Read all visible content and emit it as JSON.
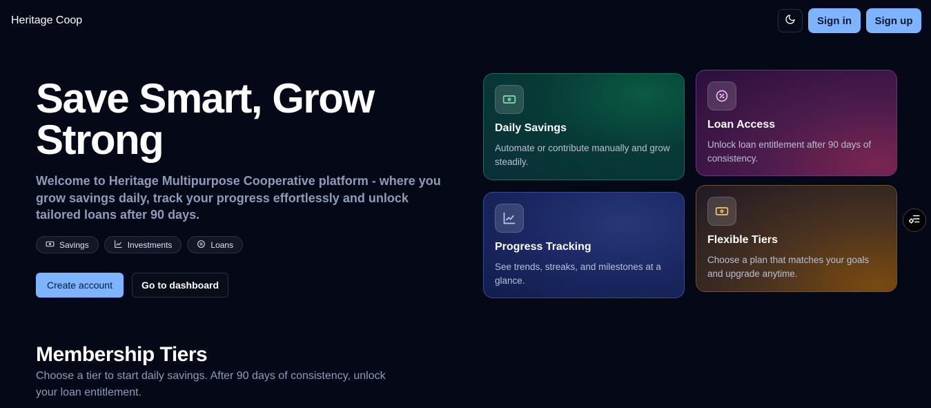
{
  "header": {
    "brand": "Heritage Coop",
    "theme_toggle_icon": "moon-icon",
    "signin_label": "Sign in",
    "signup_label": "Sign up"
  },
  "hero": {
    "title": "Save Smart, Grow Strong",
    "subtitle": "Welcome to Heritage Multipurpose Cooperative platform - where you grow savings daily, track your progress effortlessly and unlock tailored loans after 90 days.",
    "chips": [
      {
        "label": "Savings",
        "icon": "cash-icon"
      },
      {
        "label": "Investments",
        "icon": "chart-line-icon"
      },
      {
        "label": "Loans",
        "icon": "percent-badge-icon"
      }
    ],
    "cta_primary": "Create account",
    "cta_secondary": "Go to dashboard"
  },
  "features": [
    {
      "title": "Daily Savings",
      "desc": "Automate or contribute manually and grow steadily.",
      "icon": "cash-icon",
      "accent": "#7be0b6"
    },
    {
      "title": "Loan Access",
      "desc": "Unlock loan entitlement after 90 days of consistency.",
      "icon": "percent-badge-icon",
      "accent": "#f0b8ff"
    },
    {
      "title": "Progress Tracking",
      "desc": "See trends, streaks, and milestones at a glance.",
      "icon": "chart-line-icon",
      "accent": "#b9c8ff"
    },
    {
      "title": "Flexible Tiers",
      "desc": "Choose a plan that matches your goals and upgrade anytime.",
      "icon": "cash-icon",
      "accent": "#f5c46a"
    }
  ],
  "membership": {
    "title": "Membership Tiers",
    "subtitle": "Choose a tier to start daily savings. After 90 days of consistency, unlock your loan entitlement."
  },
  "floating": {
    "icon": "settings-list-icon"
  },
  "colors": {
    "background": "#050816",
    "primary": "#7eb3ff",
    "muted_text": "#8f9bb8"
  }
}
